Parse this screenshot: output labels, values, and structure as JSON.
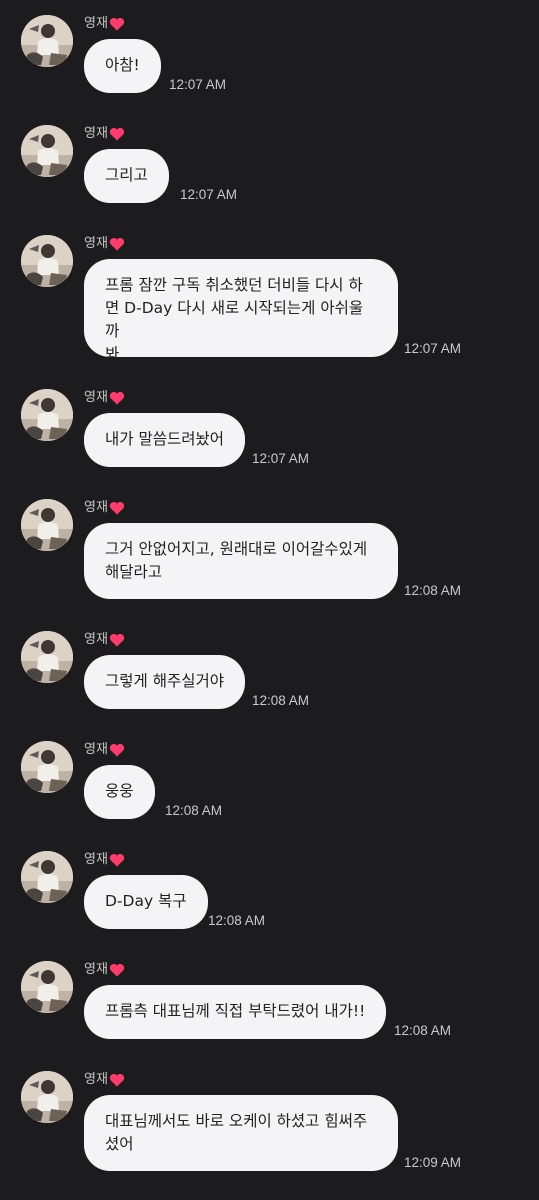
{
  "messages": [
    {
      "sender": "영재",
      "text": "아참!",
      "time": "12:07 AM"
    },
    {
      "sender": "영재",
      "text": "그리고",
      "time": "12:07 AM"
    },
    {
      "sender": "영재",
      "text": "프롬 잠깐 구독 취소했던 더비들 다시 하\n면 D-Day 다시 새로 시작되는게 아쉬울까\n봐",
      "time": "12:07 AM"
    },
    {
      "sender": "영재",
      "text": "내가 말씀드려놨어",
      "time": "12:07 AM"
    },
    {
      "sender": "영재",
      "text": "그거 안없어지고, 원래대로 이어갈수있게\n해달라고",
      "time": "12:08 AM"
    },
    {
      "sender": "영재",
      "text": "그렇게 해주실거야",
      "time": "12:08 AM"
    },
    {
      "sender": "영재",
      "text": "웅웅",
      "time": "12:08 AM"
    },
    {
      "sender": "영재",
      "text": "D-Day 복구",
      "time": "12:08 AM"
    },
    {
      "sender": "영재",
      "text": "프롬측 대표님께 직접 부탁드렸어 내가!!",
      "time": "12:08 AM"
    },
    {
      "sender": "영재",
      "text": "대표님께서도 바로 오케이 하셨고 힘써주\n셨어",
      "time": "12:09 AM"
    }
  ],
  "colors": {
    "background": "#1c1c1f",
    "bubble": "#f4f4f6",
    "bubble_text": "#222222",
    "meta_text": "#c9c9c9",
    "heart": "#ff3b6b"
  },
  "icons": {
    "heart": "heart-icon",
    "avatar": "profile-photo"
  }
}
